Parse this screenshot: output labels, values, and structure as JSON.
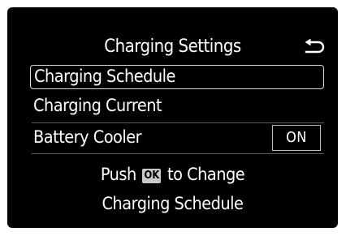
{
  "header": {
    "title": "Charging Settings",
    "back_icon": "back-arrow-icon"
  },
  "menu": {
    "items": [
      {
        "label": "Charging Schedule",
        "selected": true
      },
      {
        "label": "Charging Current",
        "selected": false
      },
      {
        "label": "Battery Cooler",
        "value": "ON",
        "selected": false
      }
    ]
  },
  "hint": {
    "prefix": "Push",
    "button_label": "OK",
    "suffix": "to Change",
    "target": "Charging Schedule"
  },
  "colors": {
    "background": "#000000",
    "text": "#ffffff",
    "selection_border": "#d9d9d9",
    "ok_badge": "#c9c9c9"
  }
}
